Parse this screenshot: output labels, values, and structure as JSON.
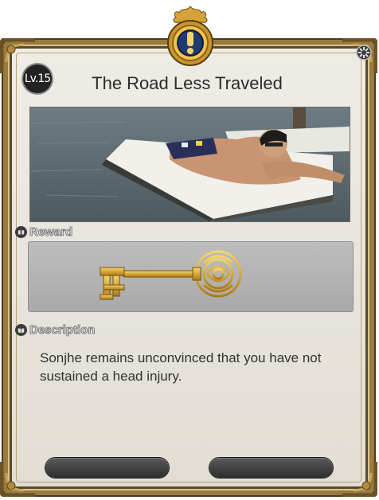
{
  "quest": {
    "level": "Lv.15",
    "title": "The Road Less Traveled"
  },
  "sections": {
    "reward_label": "Reward",
    "description_label": "Description"
  },
  "description": "Sonjhe remains unconvinced that you have not sustained a head injury.",
  "reward": {
    "item_icon": "golden-key-icon"
  },
  "icons": {
    "emblem": "exclamation-emblem-icon",
    "settings": "gear-icon"
  },
  "buttons": {
    "left_label": "",
    "right_label": ""
  },
  "colors": {
    "frame_gold": "#9a7a3e",
    "emblem_gold": "#e8b43a",
    "panel_bg": "#e8e4dd",
    "button_dark": "#3a3a3a"
  }
}
